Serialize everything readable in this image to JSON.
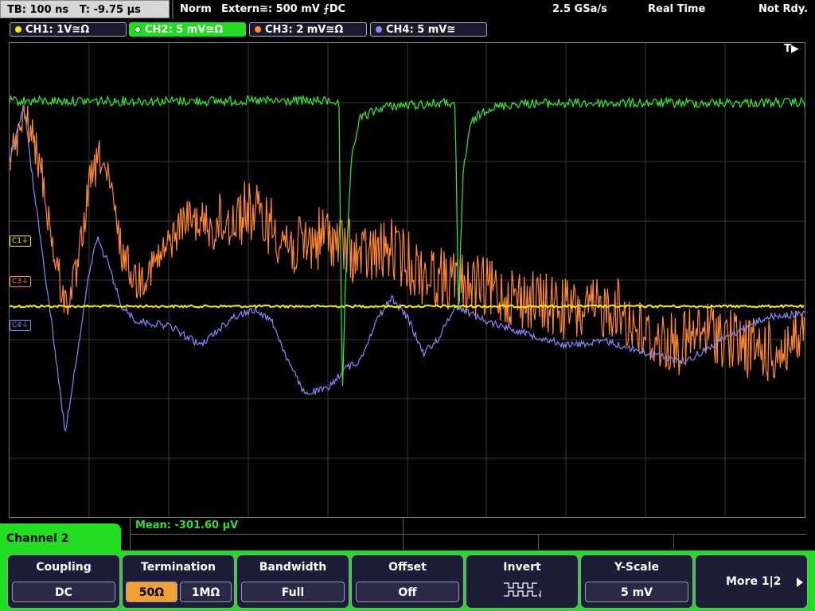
{
  "header": {
    "timebase": "TB: 100 ns",
    "trigger_time": "T: -9.75 µs",
    "trigger_mode": "Norm",
    "trigger_source": "Extern≅: 500 mV ⨍DC",
    "sample_rate": "2.5 GSa/s",
    "acq_mode": "Real Time",
    "status": "Not Rdy."
  },
  "channels": [
    {
      "label": "CH1: 1V≅Ω",
      "color": "#ffee00"
    },
    {
      "label": "CH2: 5 mV≅Ω",
      "color": "#33ee33"
    },
    {
      "label": "CH3: 2 mV≅Ω",
      "color": "#ff8833"
    },
    {
      "label": "CH4: 5 mV≅",
      "color": "#8888ff"
    }
  ],
  "markers": {
    "c1": "C1",
    "c3": "C3",
    "c4": "C4",
    "trigger": "T▶"
  },
  "measurement": {
    "text": "Mean: -301.60 µV"
  },
  "menu": {
    "tab_title": "Channel 2",
    "coupling": {
      "title": "Coupling",
      "value": "DC"
    },
    "termination": {
      "title": "Termination",
      "opt1": "50Ω",
      "opt2": "1MΩ"
    },
    "bandwidth": {
      "title": "Bandwidth",
      "value": "Full"
    },
    "offset": {
      "title": "Offset",
      "value": "Off"
    },
    "invert": {
      "title": "Invert"
    },
    "yscale": {
      "title": "Y-Scale",
      "value": "5 mV"
    },
    "more": {
      "title": "More 1|2"
    }
  },
  "colors": {
    "ch1": "#ffee00",
    "ch2": "#33ee33",
    "ch3": "#ff8833",
    "ch4": "#8888ff",
    "menu_accent": "#22dd22"
  }
}
